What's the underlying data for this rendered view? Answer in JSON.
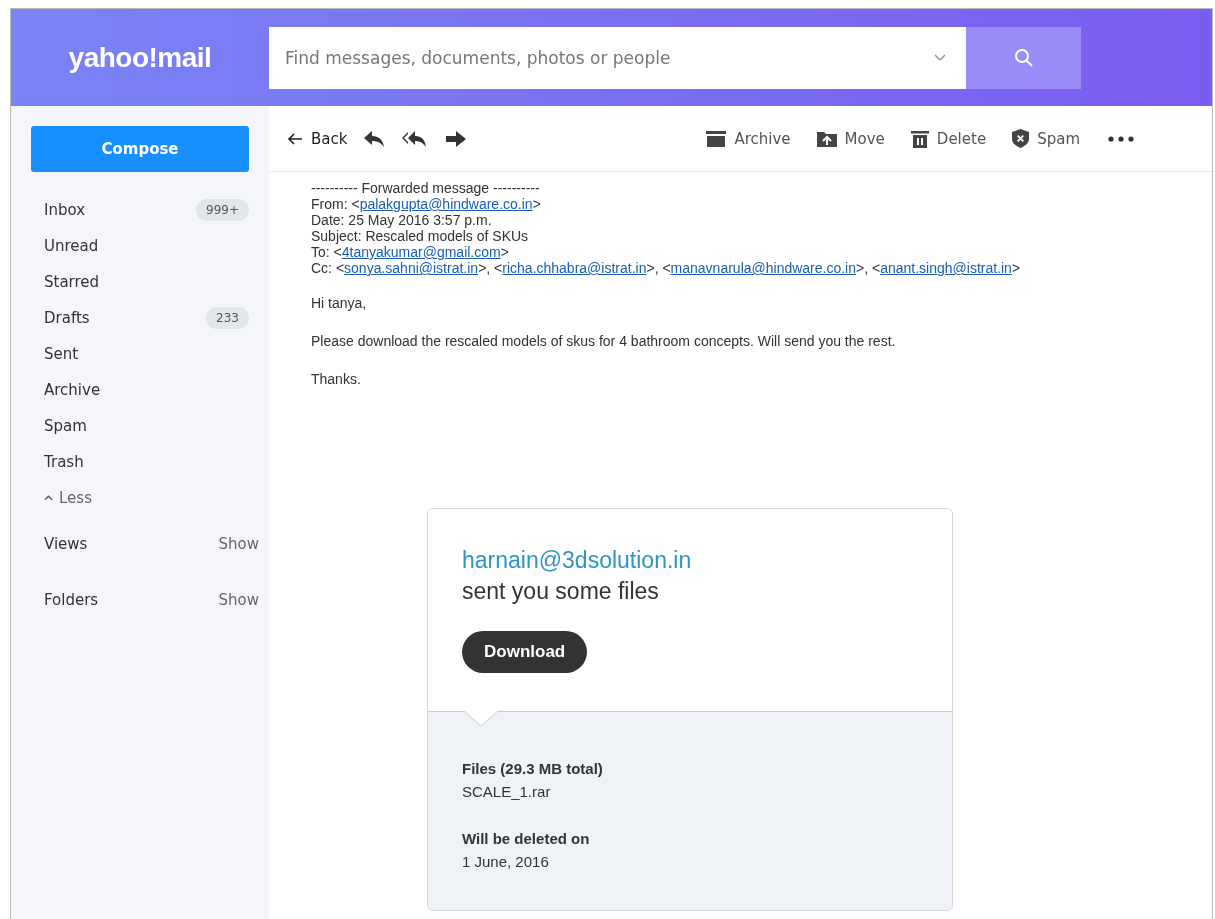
{
  "logo": "yahoo!mail",
  "search": {
    "placeholder": "Find messages, documents, photos or people"
  },
  "compose": "Compose",
  "folders": [
    {
      "label": "Inbox",
      "count": "999+"
    },
    {
      "label": "Unread"
    },
    {
      "label": "Starred"
    },
    {
      "label": "Drafts",
      "count": "233"
    },
    {
      "label": "Sent"
    },
    {
      "label": "Archive"
    },
    {
      "label": "Spam"
    },
    {
      "label": "Trash"
    }
  ],
  "less": "Less",
  "sections": [
    {
      "label": "Views",
      "action": "Show"
    },
    {
      "label": "Folders",
      "action": "Show"
    }
  ],
  "toolbar": {
    "back": "Back",
    "actions": [
      "Archive",
      "Move",
      "Delete",
      "Spam"
    ]
  },
  "message": {
    "forwarded": "---------- Forwarded message ----------",
    "header_lines": [
      [
        {
          "text": "From: <"
        },
        {
          "link": "palakgupta@hindware.co.in"
        },
        {
          "text": ">"
        }
      ],
      [
        {
          "text": "Date: 25 May 2016 3:57 p.m."
        }
      ],
      [
        {
          "text": "Subject: Rescaled models of SKUs"
        }
      ],
      [
        {
          "text": "To: <"
        },
        {
          "link": "4tanyakumar@gmail.com"
        },
        {
          "text": ">"
        }
      ],
      [
        {
          "text": "Cc: <"
        },
        {
          "link": "sonya.sahni@istrat.in"
        },
        {
          "text": ">, <"
        },
        {
          "link": "richa.chhabra@istrat.in"
        },
        {
          "text": ">, <"
        },
        {
          "link": "manavnarula@hindware.co.in"
        },
        {
          "text": ">, <"
        },
        {
          "link": "anant.singh@istrat.in"
        },
        {
          "text": ">"
        }
      ]
    ],
    "paragraphs": [
      "Hi tanya,",
      "Please download the rescaled models of skus for 4 bathroom concepts. Will send you the rest.",
      "Thanks."
    ]
  },
  "transfer_card": {
    "sender": "harnain@3dsolution.in",
    "headline": "sent you some files",
    "button": "Download",
    "files_title": "Files (29.3 MB total)",
    "files": [
      "SCALE_1.rar"
    ],
    "deleted_title": "Will be deleted on",
    "deleted_date": "1 June, 2016"
  }
}
